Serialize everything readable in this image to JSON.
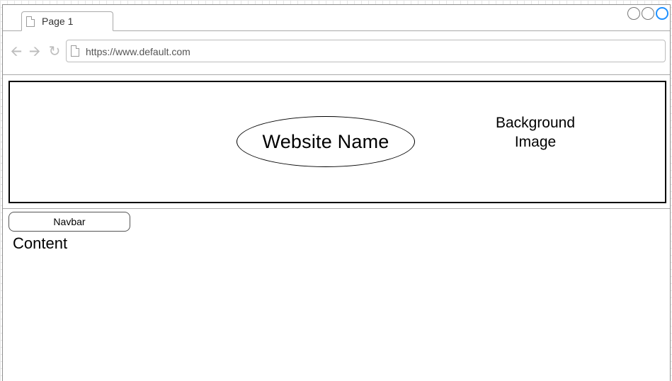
{
  "browser": {
    "tab": {
      "label": "Page 1"
    },
    "url": "https://www.default.com"
  },
  "header": {
    "site_name": "Website Name",
    "background_label": "Background\nImage"
  },
  "navbar": {
    "label": "Navbar"
  },
  "content": {
    "label": "Content"
  },
  "icons": {
    "tab": "page-icon",
    "url": "page-icon",
    "back": "arrow-left-icon",
    "forward": "arrow-right-icon",
    "reload": "reload-icon"
  },
  "colors": {
    "accent_close": "#1e90ff",
    "chrome_border": "#a9a9a9",
    "nav_icon": "#bdbdbd"
  }
}
